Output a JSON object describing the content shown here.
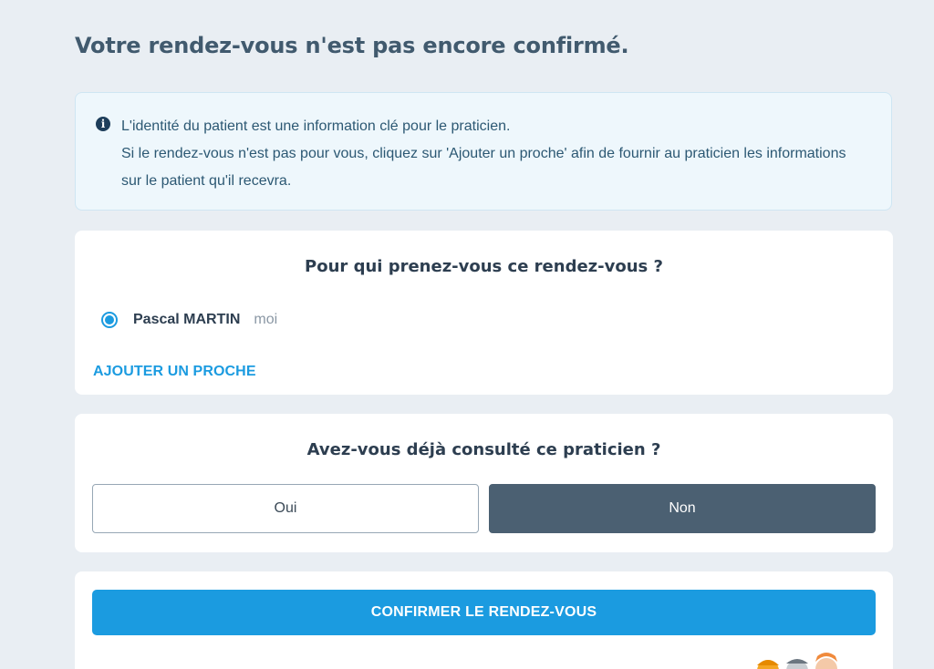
{
  "page": {
    "title": "Votre rendez-vous n'est pas encore confirmé."
  },
  "info": {
    "icon": "info-circle-icon",
    "line1": "L'identité du patient est une information clé pour le praticien.",
    "line2": "Si le rendez-vous n'est pas pour vous, cliquez sur 'Ajouter un proche' afin de fournir au praticien les informations sur le patient qu'il recevra."
  },
  "patient_section": {
    "title": "Pour qui prenez-vous ce rendez-vous ?",
    "patients": [
      {
        "name": "Pascal MARTIN",
        "tag": "moi",
        "selected": true
      }
    ],
    "add_link": "AJOUTER UN PROCHE"
  },
  "consult_section": {
    "title": "Avez-vous déjà consulté ce praticien ?",
    "options": [
      {
        "label": "Oui",
        "selected": false
      },
      {
        "label": "Non",
        "selected": true
      }
    ]
  },
  "confirm": {
    "button_label": "CONFIRMER LE RENDEZ-VOUS"
  },
  "colors": {
    "accent": "#1b9be0",
    "selected_option": "#4b6072",
    "background": "#e9eef3",
    "info_background": "#eef7fc"
  }
}
